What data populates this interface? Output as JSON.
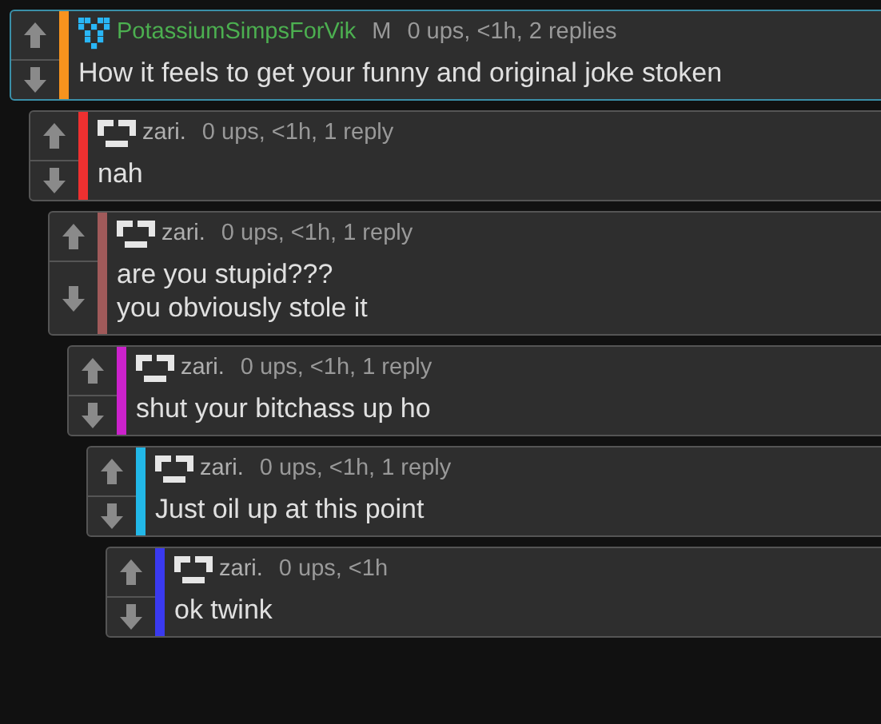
{
  "comments": [
    {
      "kind": "op",
      "username": "PotassiumSimpsForVik",
      "badge": "M",
      "meta": "0 ups, <1h, 2 replies",
      "lines": [
        "How it feels to get your funny and original joke stoken"
      ],
      "color": "#f7931e",
      "highlighted": true,
      "children": [
        {
          "kind": "reply",
          "username": "zari.",
          "meta": "0 ups, <1h, 1 reply",
          "lines": [
            "nah"
          ],
          "color": "#ee3030",
          "highlighted": false,
          "children": [
            {
              "kind": "reply",
              "username": "zari.",
              "meta": "0 ups, <1h, 1 reply",
              "lines": [
                "are you stupid???",
                "you obviously stole it"
              ],
              "color": "#a05a5a",
              "highlighted": false,
              "children": [
                {
                  "kind": "reply",
                  "username": "zari.",
                  "meta": "0 ups, <1h, 1 reply",
                  "lines": [
                    "shut your bitchass up ho"
                  ],
                  "color": "#cc22cc",
                  "highlighted": false,
                  "children": [
                    {
                      "kind": "reply",
                      "username": "zari.",
                      "meta": "0 ups, <1h, 1 reply",
                      "lines": [
                        "Just oil up at this point"
                      ],
                      "color": "#22b8e8",
                      "highlighted": false,
                      "children": [
                        {
                          "kind": "reply",
                          "username": "zari.",
                          "meta": "0 ups, <1h",
                          "lines": [
                            "ok twink"
                          ],
                          "color": "#3a3af0",
                          "highlighted": false
                        }
                      ]
                    }
                  ]
                }
              ]
            }
          ]
        }
      ]
    }
  ]
}
